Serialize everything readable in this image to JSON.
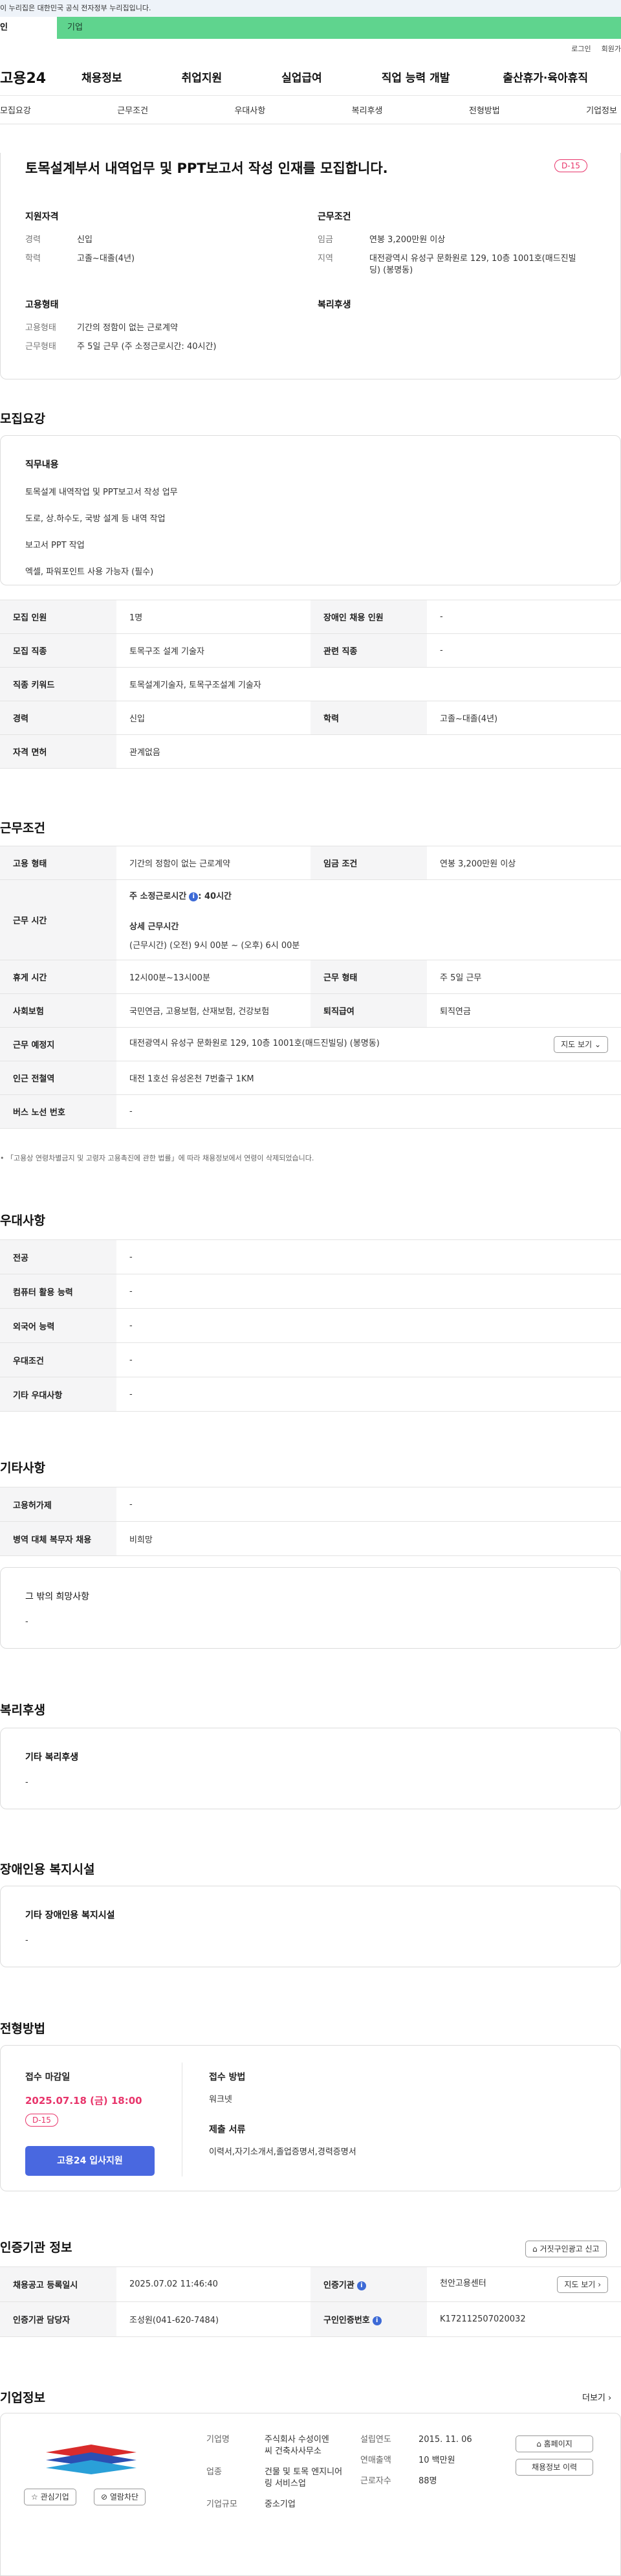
{
  "gov_notice": "이 누리집은 대한민국 공식 전자정부 누리집입니다.",
  "tabs": {
    "individual": "인",
    "corporate": "기업"
  },
  "util": {
    "login": "로그인",
    "join": "회원가"
  },
  "gnb": {
    "logo": "고용24",
    "items": [
      "채용정보",
      "취업지원",
      "실업급여",
      "직업 능력 개발",
      "출산휴가·육아휴직"
    ]
  },
  "anchor_nav": [
    "모집요강",
    "근무조건",
    "우대사항",
    "복리후생",
    "전형방법",
    "기업정보"
  ],
  "post": {
    "title": "토목설계부서 내역업무 및 PPT보고서 작성 인재를 모집합니다.",
    "dday": "D-15",
    "qual_title": "지원자격",
    "qual": [
      {
        "k": "경력",
        "v": "신입"
      },
      {
        "k": "학력",
        "v": "고졸~대졸(4년)"
      }
    ],
    "cond_title": "근무조건",
    "cond": [
      {
        "k": "임금",
        "v": "연봉 3,200만원 이상"
      },
      {
        "k": "지역",
        "v": "대전광역시 유성구 문화원로 129, 10층 1001호(매드진빌딩) (봉명동)"
      }
    ],
    "emp_title": "고용형태",
    "emp": [
      {
        "k": "고용형태",
        "v": "기간의 정함이 없는 근로계약"
      },
      {
        "k": "근무형태",
        "v": "주 5일 근무 (주 소정근로시간: 40시간)"
      }
    ],
    "welfare_title": "복리후생"
  },
  "recruit": {
    "heading": "모집요강",
    "job_title": "직무내용",
    "job_lines": [
      "토목설계 내역작업 및 PPT보고서 작성 업무",
      "도로, 상.하수도, 국방 설계 등 내역 작업",
      "보고서 PPT 작업",
      "엑셀, 파워포인트 사용 가능자 (필수)"
    ],
    "table": [
      {
        "k1": "모집 인원",
        "v1": "1명",
        "k2": "장애인 채용 인원",
        "v2": "-"
      },
      {
        "k1": "모집 직종",
        "v1": "토목구조 설계 기술자",
        "k2": "관련 직종",
        "v2": "-"
      },
      {
        "k1": "직종 키워드",
        "v1": "토목설계기술자, 토목구조설계 기술자"
      },
      {
        "k1": "경력",
        "v1": "신입",
        "k2": "학력",
        "v2": "고졸~대졸(4년)"
      },
      {
        "k1": "자격 면허",
        "v1": "관계없음"
      }
    ]
  },
  "work": {
    "heading": "근무조건",
    "emp_type_k": "고용 형태",
    "emp_type_v": "기간의 정함이 없는 근로계약",
    "wage_k": "임금 조건",
    "wage_v": "연봉 3,200만원 이상",
    "hours_k": "근무 시간",
    "hours_main": "주 소정근로시간",
    "hours_val": ": 40시간",
    "hours_detail_title": "상세 근무시간",
    "hours_detail": "(근무시간) (오전) 9시 00분 ~ (오후) 6시 00분",
    "break_k": "휴게 시간",
    "break_v": "12시00분~13시00분",
    "shape_k": "근무 형태",
    "shape_v": "주 5일 근무",
    "ins_k": "사회보험",
    "ins_v": "국민연금, 고용보험, 산재보험, 건강보험",
    "retire_k": "퇴직급여",
    "retire_v": "퇴직연금",
    "loc_k": "근무 예정지",
    "loc_v": "대전광역시 유성구 문화원로 129, 10층 1001호(매드진빌딩) (봉명동)",
    "map_btn": "지도 보기",
    "sub_k": "인근 전철역",
    "sub_v": "대전 1호선 유성온천 7번출구 1KM",
    "bus_k": "버스 노선 번호",
    "bus_v": "-",
    "notice": "「고용상 연령차별금지 및 고령자 고용촉진에 관한 법률」에 따라 채용정보에서 연령이 삭제되었습니다."
  },
  "pref": {
    "heading": "우대사항",
    "rows": [
      {
        "k": "전공",
        "v": "-"
      },
      {
        "k": "컴퓨터 활용 능력",
        "v": "-"
      },
      {
        "k": "외국어 능력",
        "v": "-"
      },
      {
        "k": "우대조건",
        "v": "-"
      },
      {
        "k": "기타 우대사항",
        "v": "-"
      }
    ]
  },
  "etc": {
    "heading": "기타사항",
    "rows": [
      {
        "k": "고용허가제",
        "v": "-"
      },
      {
        "k": "병역 대체 복무자 채용",
        "v": "비희망"
      }
    ],
    "hope_title": "그 밖의 희망사항",
    "hope_v": "-"
  },
  "welfare": {
    "heading": "복리후생",
    "box_title": "기타 복리후생",
    "box_v": "-"
  },
  "disabled": {
    "heading": "장애인용 복지시설",
    "box_title": "기타 장애인용 복지시설",
    "box_v": "-"
  },
  "selection": {
    "heading": "전형방법",
    "deadline_title": "접수 마감일",
    "deadline": "2025.07.18 (금) 18:00",
    "dday": "D-15",
    "apply_btn": "고용24 입사지원",
    "method_title": "접수 방법",
    "method": "워크넷",
    "docs_title": "제출 서류",
    "docs": "이력서,자기소개서,졸업증명서,경력증명서"
  },
  "cert": {
    "heading": "인증기관 정보",
    "report_btn": "거짓구인광고 신고",
    "reg_k": "채용공고 등록일시",
    "reg_v": "2025.07.02 11:46:40",
    "org_k": "인증기관",
    "org_v": "천안고용센터",
    "map_btn": "지도 보기",
    "mgr_k": "인증기관 담당자",
    "mgr_v": "조성원(041-620-7484)",
    "no_k": "구인인증번호",
    "no_v": "K172112507020032"
  },
  "company": {
    "heading": "기업정보",
    "more": "더보기",
    "fav_btn": "관심기업",
    "block_btn": "열람차단",
    "name_k": "기업명",
    "name_v": "주식회사 수성이엔씨 건축사사무소",
    "est_k": "설립연도",
    "est_v": "2015. 11. 06",
    "home_btn": "홈페이지",
    "sales_k": "연매출액",
    "sales_v": "10 백만원",
    "jobs_btn": "채용정보 이력",
    "emp_k": "근로자수",
    "emp_v": "88명",
    "ind_k": "업종",
    "ind_v": "건물 및 토목 엔지니어링 서비스업",
    "size_k": "기업규모",
    "size_v": "중소기업"
  }
}
